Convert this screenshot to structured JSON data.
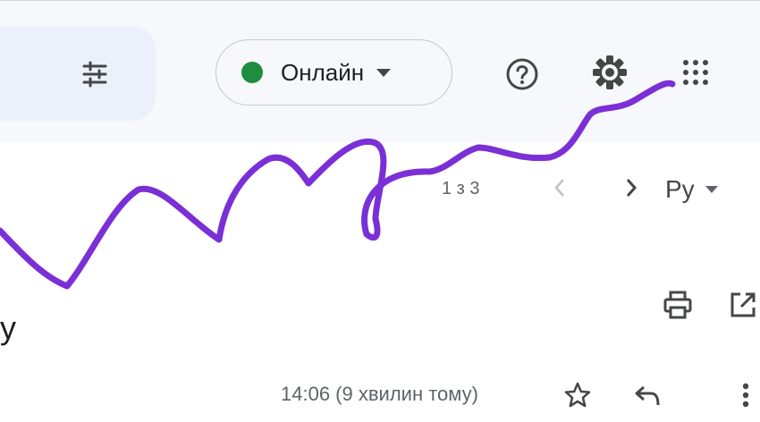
{
  "toolbar": {
    "status_label": "Онлайн",
    "status_color": "#1e8e3e",
    "filter_icon": "tune-icon",
    "help_icon": "help-circle-icon",
    "settings_icon": "gear-icon",
    "apps_icon": "apps-grid-icon"
  },
  "pagination": {
    "text": "1 з 3",
    "prev_icon": "chevron-left-icon",
    "next_icon": "chevron-right-icon"
  },
  "language": {
    "label": "Ру"
  },
  "message": {
    "subject_fragment": "у",
    "timestamp": "14:06 (9 хвилин тому)",
    "print_icon": "print-icon",
    "popout_icon": "open-in-new-window-icon",
    "star_icon": "star-outline-icon",
    "reply_icon": "reply-icon",
    "more_icon": "more-vertical-icon"
  },
  "annotation": {
    "stroke_color": "#7b2fd6"
  }
}
